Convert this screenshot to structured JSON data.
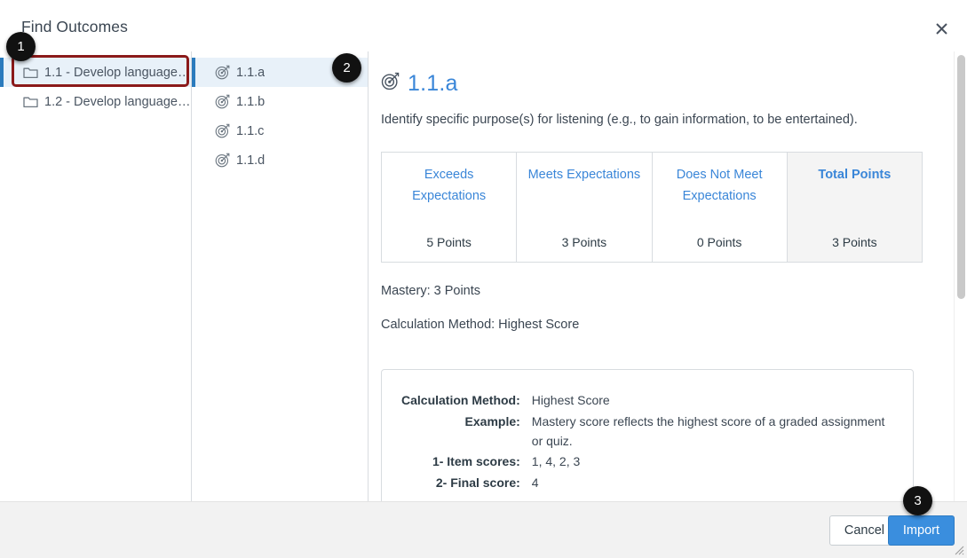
{
  "dialog": {
    "title": "Find Outcomes",
    "close_icon": "close-icon",
    "close_label": "×"
  },
  "folders": {
    "items": [
      {
        "label": "1.1 - Develop language ...",
        "icon": "folder-icon",
        "selected": true
      },
      {
        "label": "1.2 - Develop language ...",
        "icon": "folder-icon",
        "selected": false
      }
    ]
  },
  "outcomes": {
    "items": [
      {
        "label": "1.1.a",
        "icon": "outcome-target-icon",
        "selected": true
      },
      {
        "label": "1.1.b",
        "icon": "outcome-target-icon",
        "selected": false
      },
      {
        "label": "1.1.c",
        "icon": "outcome-target-icon",
        "selected": false
      },
      {
        "label": "1.1.d",
        "icon": "outcome-target-icon",
        "selected": false
      }
    ]
  },
  "detail": {
    "icon": "outcome-target-icon",
    "title": "1.1.a",
    "description": "Identify specific purpose(s) for listening (e.g., to gain information, to be entertained).",
    "rubric": {
      "columns": [
        {
          "name": "Exceeds Expectations",
          "points": "5 Points",
          "total": false
        },
        {
          "name": "Meets Expectations",
          "points": "3 Points",
          "total": false
        },
        {
          "name": "Does Not Meet Expectations",
          "points": "0 Points",
          "total": false
        },
        {
          "name": "Total Points",
          "points": "3 Points",
          "total": true
        }
      ]
    },
    "mastery_line": "Mastery: 3 Points",
    "calculation_line": "Calculation Method: Highest Score",
    "calculation_box": {
      "rows": [
        {
          "key": "Calculation Method:",
          "value": "Highest Score"
        },
        {
          "key": "Example:",
          "value": "Mastery score reflects the highest score of a graded assignment or quiz."
        },
        {
          "key": "1- Item scores:",
          "value": "1, 4, 2, 3"
        },
        {
          "key": "2- Final score:",
          "value": "4"
        }
      ]
    }
  },
  "footer": {
    "cancel_label": "Cancel",
    "import_label": "Import"
  },
  "annotations": {
    "callouts": [
      {
        "number": "1"
      },
      {
        "number": "2"
      },
      {
        "number": "3"
      }
    ]
  },
  "colors": {
    "accent_blue": "#3a86d8",
    "selected_bg": "#e8f1f9",
    "selected_bar": "#2b7bbd",
    "import_button": "#3a8ede",
    "highlight_red": "#8b1a1a",
    "callout_black": "#111111"
  }
}
